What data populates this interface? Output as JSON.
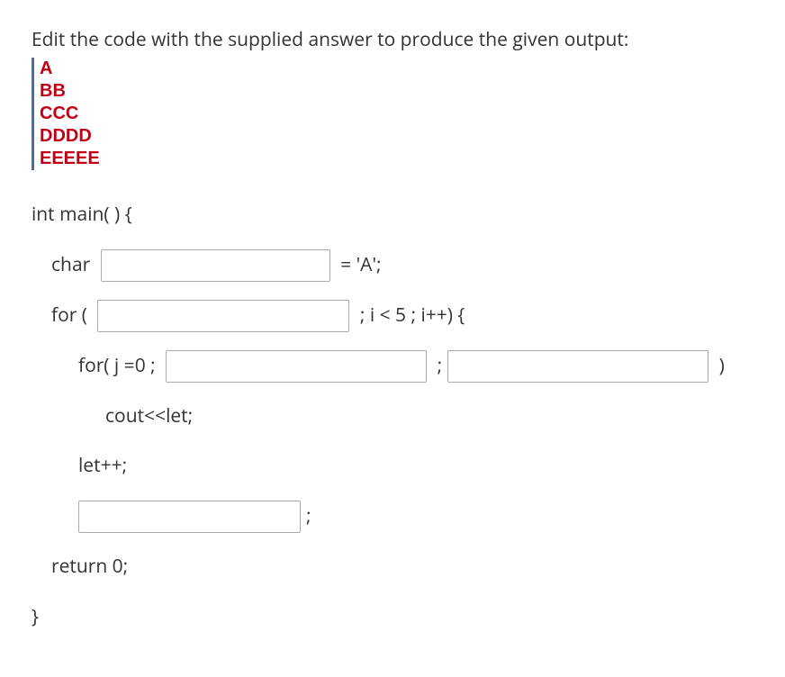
{
  "instruction": "Edit the code with the supplied answer to produce the given output:",
  "output": [
    "A",
    "BB",
    "CCC",
    "DDDD",
    "EEEEE"
  ],
  "code": {
    "line_main": "int main( ) {",
    "char_label": "char ",
    "char_tail": " = 'A';",
    "for1_lead": "for ( ",
    "for1_tail": " ; i < 5 ; i++) {",
    "for2_lead": "for( j =0 ; ",
    "for2_mid": " ;",
    "for2_tail": " )",
    "cout_line": "cout<<let;",
    "letpp_line": "let++;",
    "semicolon": ";",
    "return_line": "return 0;",
    "brace": "}"
  },
  "blanks": {
    "b1": "",
    "b2": "",
    "b3": "",
    "b4": "",
    "b5": ""
  }
}
